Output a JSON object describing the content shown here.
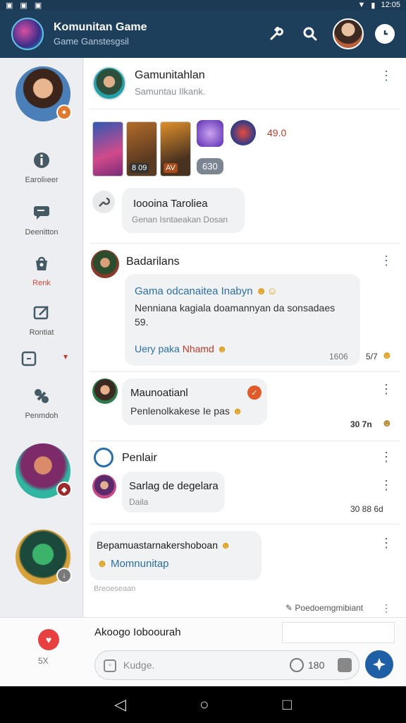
{
  "status_bar": {
    "time": "12:05"
  },
  "app_bar": {
    "title": "Komunitan Game",
    "subtitle": "Game Ganstesgsil",
    "actions": [
      "wrench-icon",
      "search-icon",
      "user-avatar",
      "clock-icon"
    ]
  },
  "sidebar": {
    "items": [
      {
        "icon": "info-icon",
        "label": "Earoliıeer"
      },
      {
        "icon": "chat-icon",
        "label": "Deenitton"
      },
      {
        "icon": "bag-icon",
        "label": "Renk",
        "active": true
      },
      {
        "icon": "edit-icon",
        "label": "Rontiat"
      },
      {
        "icon": "box-icon",
        "label": ""
      },
      {
        "icon": "gamepad-icon",
        "label": "Penmdoh"
      }
    ],
    "dropdown_marker": "▾"
  },
  "posts": {
    "p1": {
      "name": "Gamunitahlan",
      "sub": "Samuntau Ilkank.",
      "price": "49.0",
      "card_badge1": "8 09",
      "card_badge2": "AV",
      "pill": "630",
      "comment_title": "Ioooina Taroliea",
      "comment_sub": "Genan Isntaeakan Dosan"
    },
    "p2": {
      "name": "Badarilans",
      "line1": "Gama odcanaitea Inabyn",
      "line2": "Nenniana kagiala doamannyan da sonsadaes",
      "line3": "59.",
      "line4a": "Uery paka",
      "line4b": "Nhamd",
      "time": "1606",
      "count": "5/7"
    },
    "p3": {
      "name": "Maunoatianl",
      "text": "Penlenolkakese Ie pas",
      "count": "30 7n"
    },
    "p4": {
      "name": "Penlair",
      "bubble_name": "Sarlag de degelara",
      "bubble_sub": "Daila",
      "count": "30 88 6d"
    },
    "p5": {
      "text": "Bepamuastarnakershoboan",
      "link": "Momnunitap",
      "sub": "Breoeseaan"
    }
  },
  "footer_hint": "Poedoemgmibiant",
  "composer": {
    "label": "Akoogo Ioboourah",
    "side_label": "5X",
    "input_placeholder": "Kudge.",
    "counter": "180"
  },
  "colors": {
    "primary": "#1e3f5c",
    "accent": "#d9473c",
    "send": "#1e5fa6"
  }
}
